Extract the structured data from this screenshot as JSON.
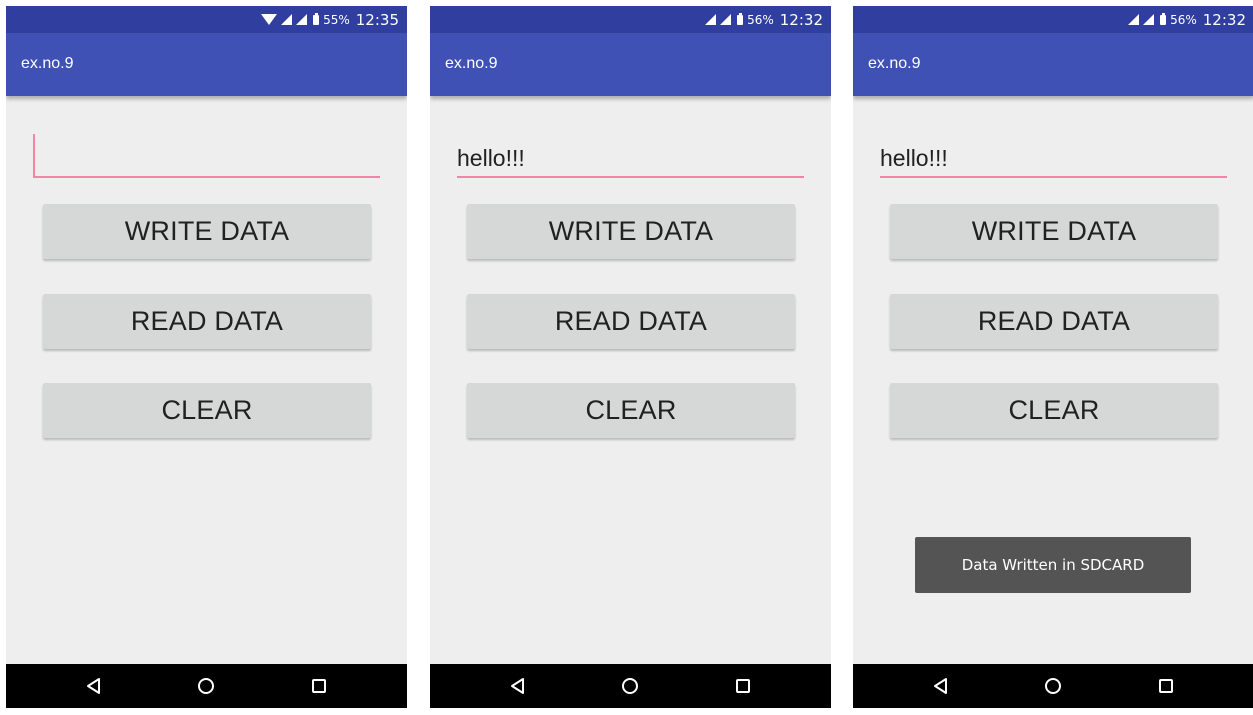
{
  "screens": [
    {
      "status": {
        "battery": "55%",
        "time": "12:35",
        "wifi": true
      },
      "app_title": "ex.no.9",
      "input": {
        "value": ""
      },
      "buttons": {
        "write": "WRITE DATA",
        "read": "READ DATA",
        "clear": "CLEAR"
      },
      "toast": ""
    },
    {
      "status": {
        "battery": "56%",
        "time": "12:32",
        "wifi": false
      },
      "app_title": "ex.no.9",
      "input": {
        "value": "hello!!!"
      },
      "buttons": {
        "write": "WRITE DATA",
        "read": "READ DATA",
        "clear": "CLEAR"
      },
      "toast": ""
    },
    {
      "status": {
        "battery": "56%",
        "time": "12:32",
        "wifi": false
      },
      "app_title": "ex.no.9",
      "input": {
        "value": "hello!!!"
      },
      "buttons": {
        "write": "WRITE DATA",
        "read": "READ DATA",
        "clear": "CLEAR"
      },
      "toast": "Data Written in SDCARD"
    }
  ],
  "colors": {
    "status_bar": "#303f9f",
    "app_bar": "#3f51b5",
    "accent": "#f284a6",
    "button": "#d6d7d7",
    "background": "#eeeeee",
    "toast": "#545454",
    "nav_bar": "#000000"
  },
  "icons": [
    "wifi-icon",
    "signal-icon",
    "battery-icon",
    "back-icon",
    "home-icon",
    "recents-icon"
  ]
}
